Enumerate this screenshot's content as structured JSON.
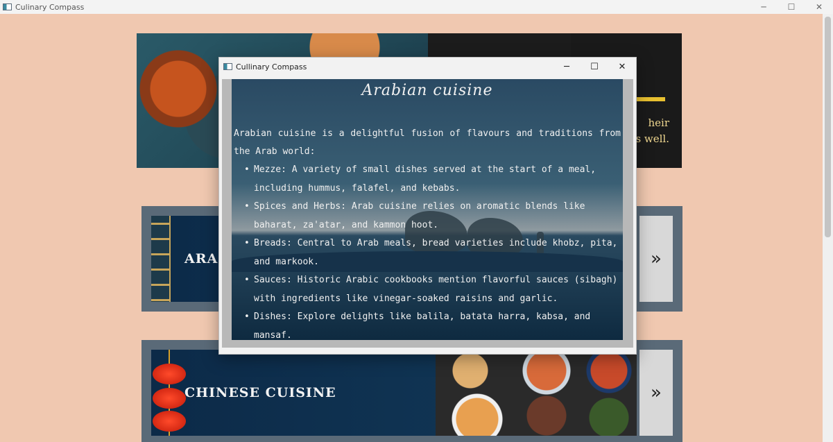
{
  "window": {
    "title": "Culinary Compass",
    "minimize": "─",
    "maximize": "☐",
    "close": "✕"
  },
  "banner": {
    "tagline_line1": "heir",
    "tagline_line2": "s well."
  },
  "cards": [
    {
      "title": "ARAB",
      "arrow": "»"
    },
    {
      "title": "CHINESE  CUISINE",
      "arrow": "»"
    }
  ],
  "dialog": {
    "title": "Cullinary Compass",
    "minimize": "─",
    "maximize": "☐",
    "close": "✕",
    "heading": "Arabian cuisine",
    "intro": "Arabian cuisine is a delightful fusion of flavours and traditions from the Arab world:",
    "items": [
      "Mezze: A variety of small dishes served at the start of a meal, including hummus, falafel, and kebabs.",
      "Spices and Herbs: Arab cuisine relies on aromatic blends like baharat, za'atar, and kammon hoot.",
      "Breads: Central to Arab meals, bread varieties include khobz, pita, and markook.",
      "Sauces: Historic Arabic cookbooks mention flavorful sauces (sibagh) with ingredients like vinegar-soaked raisins and garlic.",
      "Dishes: Explore delights like balila, batata harra, kabsa, and mansaf."
    ]
  },
  "colors": {
    "background": "#f0c8b0",
    "card_frame": "#5a6a78",
    "card_inner": "#0c2a48",
    "accent_gold": "#e8c030"
  }
}
